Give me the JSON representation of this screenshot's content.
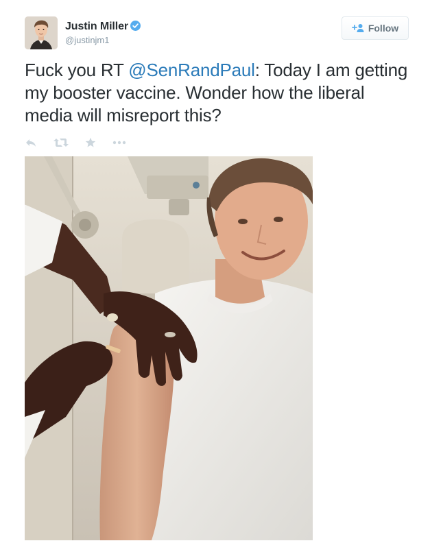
{
  "user": {
    "display_name": "Justin Miller",
    "handle": "@justinjm1",
    "verified": true
  },
  "follow_button": {
    "label": "Follow"
  },
  "tweet": {
    "prefix": "Fuck you RT ",
    "mention": "@SenRandPaul",
    "body": ": Today I am getting my booster vaccine. Wonder how the liberal media will misreport this?"
  },
  "actions": [
    {
      "icon": "reply-icon"
    },
    {
      "icon": "retweet-icon"
    },
    {
      "icon": "favorite-star-icon"
    },
    {
      "icon": "more-dots-icon"
    }
  ],
  "colors": {
    "mention": "#2b7bb9",
    "verified": "#55acee",
    "muted": "#8899a6",
    "icon": "#ccd6dd"
  }
}
